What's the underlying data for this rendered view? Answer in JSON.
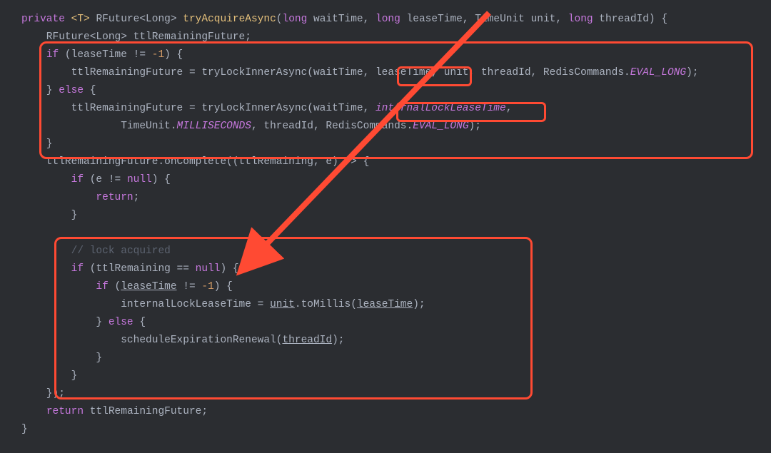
{
  "code": {
    "l1": {
      "a": "private",
      "b": "<T>",
      "c": "RFuture<Long>",
      "d": "tryAcquireAsync",
      "e": "(",
      "f": "long",
      "g": " waitTime, ",
      "h": "long",
      "i": " leaseTime, TimeUnit unit, ",
      "j": "long",
      "k": " threadId) {"
    },
    "l2": {
      "a": "    RFuture<Long> ttlRemainingFuture;"
    },
    "l3": {
      "a": "    ",
      "b": "if",
      "c": " (leaseTime != ",
      "d": "-1",
      "e": ") {"
    },
    "l4": {
      "a": "        ttlRemainingFuture = tryLockInnerAsync(waitTime, leaseTime, unit, threadId, RedisCommands.",
      "b": "EVAL_LONG",
      "c": ");"
    },
    "l5": {
      "a": "    } ",
      "b": "else",
      "c": " {"
    },
    "l6": {
      "a": "        ttlRemainingFuture = tryLockInnerAsync(waitTime, ",
      "b": "internalLockLeaseTime",
      "c": ","
    },
    "l7": {
      "a": "                TimeUnit.",
      "b": "MILLISECONDS",
      "c": ", threadId, RedisCommands.",
      "d": "EVAL_LONG",
      "e": ");"
    },
    "l8": {
      "a": "    }"
    },
    "l9": {
      "a": "    ttlRemainingFuture.onComplete((ttlRemaining, e) -> {"
    },
    "l10": {
      "a": "        ",
      "b": "if",
      "c": " (e != ",
      "d": "null",
      "e": ") {"
    },
    "l11": {
      "a": "            ",
      "b": "return",
      "c": ";"
    },
    "l12": {
      "a": "        }"
    },
    "l13": {
      "a": ""
    },
    "l14": {
      "a": "        ",
      "b": "// lock acquired"
    },
    "l15": {
      "a": "        ",
      "b": "if",
      "c": " (ttlRemaining == ",
      "d": "null",
      "e": ") {"
    },
    "l16": {
      "a": "            ",
      "b": "if",
      "c": " (",
      "d": "leaseTime",
      "e": " != ",
      "f": "-1",
      "g": ") {"
    },
    "l17": {
      "a": "                internalLockLeaseTime = ",
      "b": "unit",
      "c": ".toMillis(",
      "d": "leaseTime",
      "e": ");"
    },
    "l18": {
      "a": "            } ",
      "b": "else",
      "c": " {"
    },
    "l19": {
      "a": "                scheduleExpirationRenewal(",
      "b": "threadId",
      "c": ");"
    },
    "l20": {
      "a": "            }"
    },
    "l21": {
      "a": "        }"
    },
    "l22": {
      "a": "    });"
    },
    "l23": {
      "a": "    ",
      "b": "return",
      "c": " ttlRemainingFuture;"
    },
    "l24": {
      "a": "}"
    }
  },
  "annotations": {
    "box_large_top": {
      "desc": "highlights if/else block calling tryLockInnerAsync"
    },
    "box_small_leaseTime": {
      "desc": "highlights argument leaseTime"
    },
    "box_small_internal": {
      "desc": "highlights argument internalLockLeaseTime"
    },
    "box_large_bottom": {
      "desc": "highlights lock-acquired branch"
    },
    "arrow": {
      "desc": "arrow from top to ttlRemaining==null"
    }
  },
  "colors": {
    "accent_red": "#ff4a33",
    "keyword": "#c678dd",
    "methodName": "#e5c07b",
    "number": "#d19a66",
    "comment": "#5c6370",
    "field_italic": "#c678dd"
  }
}
